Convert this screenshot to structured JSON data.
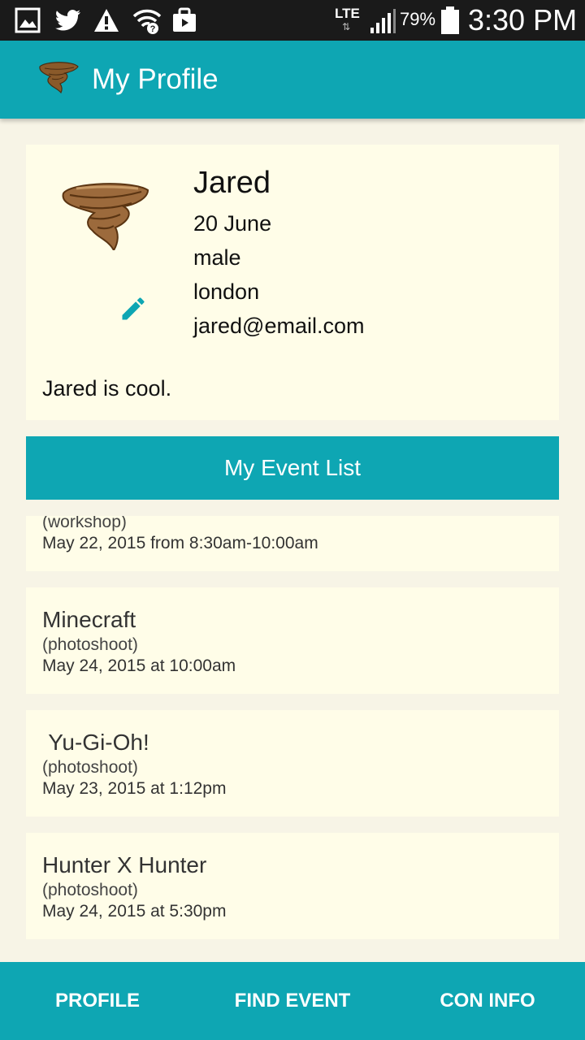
{
  "status_bar": {
    "network": "LTE",
    "battery": "79%",
    "time": "3:30 PM",
    "icons": [
      "gallery-icon",
      "twitter-icon",
      "warning-icon",
      "wifi-icon",
      "briefcase-icon",
      "signal-icon",
      "battery-icon"
    ]
  },
  "app_bar": {
    "title": "My Profile",
    "logo_icon": "tornado-logo-icon",
    "color": "#0ea6b3"
  },
  "profile": {
    "name": "Jared",
    "birthday": "20 June",
    "gender": "male",
    "location": "london",
    "email": "jared@email.com",
    "bio": "Jared is cool.",
    "avatar_icon": "tornado-avatar-icon",
    "edit_icon": "pencil-icon"
  },
  "event_list": {
    "header": "My Event List",
    "events": [
      {
        "title": "",
        "type": "(workshop)",
        "date": "May 22, 2015 from 8:30am-10:00am"
      },
      {
        "title": "Minecraft",
        "type": "(photoshoot)",
        "date": "May 24, 2015 at 10:00am"
      },
      {
        "title": " Yu-Gi-Oh!",
        "type": "(photoshoot)",
        "date": "May 23, 2015 at 1:12pm"
      },
      {
        "title": "Hunter X Hunter",
        "type": "(photoshoot)",
        "date": "May 24, 2015 at 5:30pm"
      }
    ]
  },
  "bottom_nav": {
    "items": [
      "PROFILE",
      "FIND EVENT",
      "CON INFO"
    ]
  },
  "colors": {
    "accent": "#0ea6b3",
    "card": "#fffde8",
    "background": "#f7f4e6"
  }
}
